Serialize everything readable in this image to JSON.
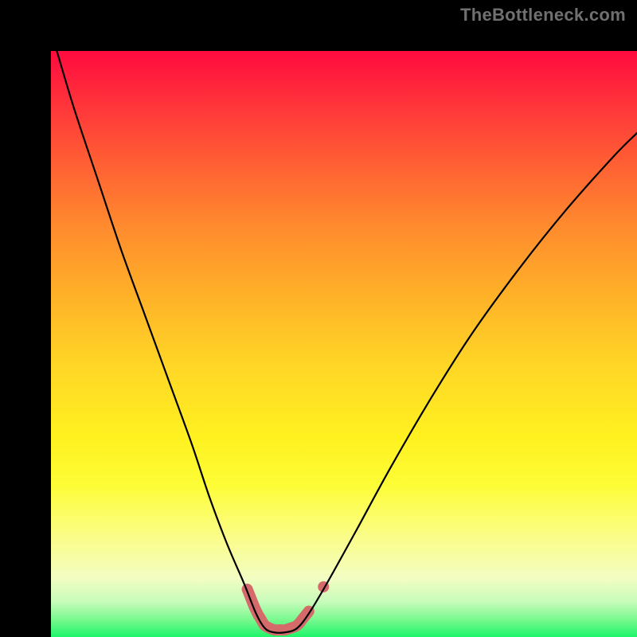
{
  "watermark": "TheBottleneck.com",
  "chart_data": {
    "type": "line",
    "title": "",
    "xlabel": "",
    "ylabel": "",
    "xlim": [
      0,
      100
    ],
    "ylim": [
      0,
      100
    ],
    "grid": false,
    "legend": null,
    "series": [
      {
        "name": "bottleneck-curve",
        "x": [
          1,
          4,
          8,
          12,
          16,
          20,
          24,
          27,
          30,
          33,
          35,
          36.5,
          38,
          40,
          42,
          44,
          47,
          52,
          58,
          65,
          72,
          80,
          88,
          96,
          100
        ],
        "y": [
          100,
          90,
          78,
          66,
          55,
          44,
          33,
          24,
          16,
          9,
          4,
          1.5,
          0.8,
          0.8,
          1.5,
          4,
          9,
          18,
          29,
          41,
          52,
          63,
          73,
          82,
          86
        ]
      }
    ],
    "markers": {
      "trough_band_x": [
        33.5,
        44
      ],
      "dot_x": 46.5,
      "color": "#d46a6a"
    },
    "background_gradient": {
      "top": "#ff0b3f",
      "mid": "#fff120",
      "bottom": "#1ef56b"
    }
  }
}
